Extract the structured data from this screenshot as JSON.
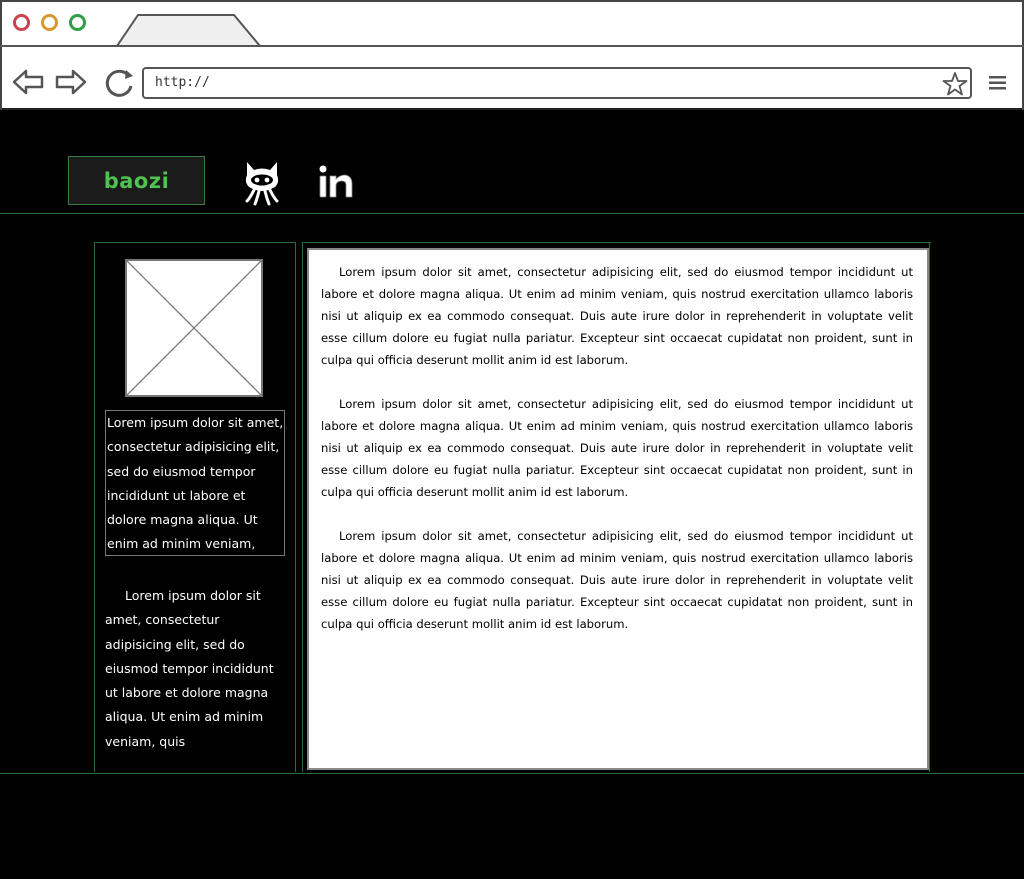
{
  "browser": {
    "url": "http://",
    "colors": {
      "close": "#c9444f",
      "minimize": "#d8992b",
      "maximize": "#2f9e45"
    }
  },
  "header": {
    "logo_text": "baozi",
    "logo_color": "#4fc24f",
    "social": [
      {
        "icon": "github-octocat-icon"
      },
      {
        "icon": "linkedin-icon"
      }
    ]
  },
  "sidebar": {
    "image_placeholder": "image-placeholder",
    "boxed_text": "Lorem ipsum dolor sit amet, consectetur adipisicing elit, sed do eiusmod tempor incididunt ut labore et dolore magna aliqua. Ut enim ad minim veniam, quis",
    "paragraph": "Lorem ipsum dolor sit amet, consectetur adipisicing elit, sed do eiusmod tempor incididunt ut labore et dolore magna aliqua. Ut enim ad minim veniam, quis"
  },
  "main": {
    "paragraphs": [
      "Lorem ipsum dolor sit amet, consectetur adipisicing elit, sed do eiusmod tempor incididunt ut labore et dolore magna aliqua. Ut enim ad minim veniam, quis nostrud exercitation ullamco laboris nisi ut aliquip ex ea commodo consequat. Duis aute irure dolor in reprehenderit in voluptate velit esse cillum dolore eu fugiat nulla pariatur. Excepteur sint occaecat cupidatat non proident, sunt in culpa qui officia deserunt mollit anim id est laborum.",
      "Lorem ipsum dolor sit amet, consectetur adipisicing elit, sed do eiusmod tempor incididunt ut labore et dolore magna aliqua. Ut enim ad minim veniam, quis nostrud exercitation ullamco laboris nisi ut aliquip ex ea commodo consequat. Duis aute irure dolor in reprehenderit in voluptate velit esse cillum dolore eu fugiat nulla pariatur. Excepteur sint occaecat cupidatat non proident, sunt in culpa qui officia deserunt mollit anim id est laborum.",
      "Lorem ipsum dolor sit amet, consectetur adipisicing elit, sed do eiusmod tempor incididunt ut labore et dolore magna aliqua. Ut enim ad minim veniam, quis nostrud exercitation ullamco laboris nisi ut aliquip ex ea commodo consequat. Duis aute irure dolor in reprehenderit in voluptate velit esse cillum dolore eu fugiat nulla pariatur. Excepteur sint occaecat cupidatat non proident, sunt in culpa qui officia deserunt mollit anim id est laborum."
    ]
  }
}
